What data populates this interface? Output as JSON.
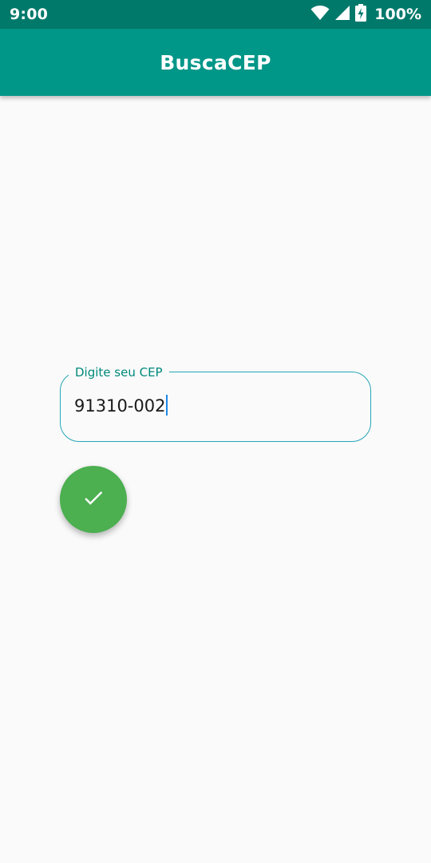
{
  "status_bar": {
    "time": "9:00",
    "battery_percent": "100%",
    "icons": [
      "wifi-icon",
      "signal-icon",
      "battery-charging-icon"
    ]
  },
  "app_bar": {
    "title": "BuscaCEP"
  },
  "cep_field": {
    "label": "Digite seu CEP",
    "value": "91310-002"
  },
  "fab": {
    "icon": "check-icon"
  },
  "colors": {
    "status_bar": "#00796b",
    "app_bar": "#009688",
    "field_border": "#26a6b8",
    "label": "#00897b",
    "fab": "#4caf50",
    "background": "#fafafa"
  }
}
